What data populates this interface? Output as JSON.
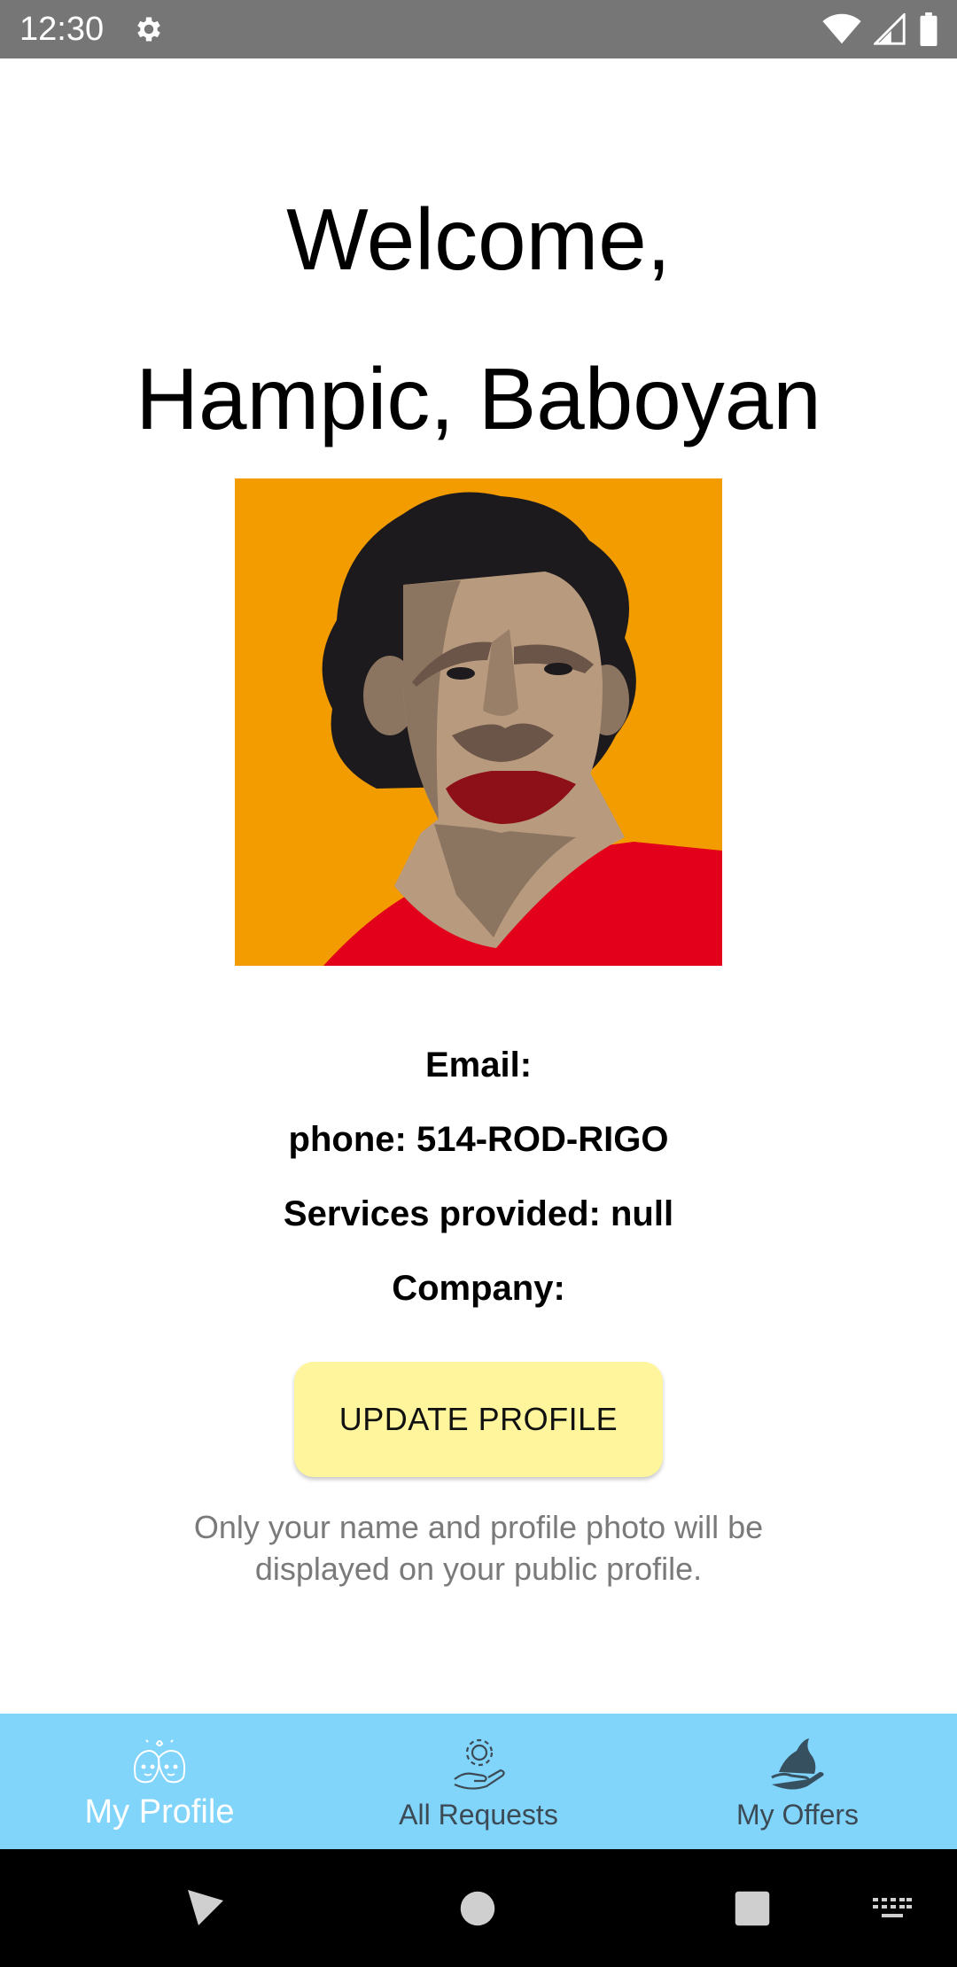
{
  "status_bar": {
    "time": "12:30",
    "icons": [
      "settings-gear-icon",
      "wifi-icon",
      "signal-icon",
      "battery-icon"
    ]
  },
  "welcome": {
    "line1": "Welcome,",
    "line2": "Hampic, Baboyan"
  },
  "profile": {
    "email_label": "Email:",
    "phone_line": "phone: 514-ROD-RIGO",
    "services_line": "Services provided: null",
    "company_label": "Company:"
  },
  "update_button_label": "UPDATE PROFILE",
  "note": "Only your name and profile photo will be displayed on your public profile.",
  "bottom_nav": {
    "tabs": [
      {
        "label": "My Profile",
        "icon": "people-faces-icon",
        "active": true
      },
      {
        "label": "All Requests",
        "icon": "gear-hand-icon",
        "active": false
      },
      {
        "label": "My Offers",
        "icon": "hand-offer-icon",
        "active": false
      }
    ]
  },
  "colors": {
    "status_bar": "#767676",
    "button": "#fff59d",
    "nav_bar": "#81d4fa",
    "avatar_bg": "#f39c00",
    "shirt": "#e2001a"
  },
  "system_nav": [
    "back-icon",
    "home-icon",
    "recents-icon",
    "keyboard-icon"
  ]
}
